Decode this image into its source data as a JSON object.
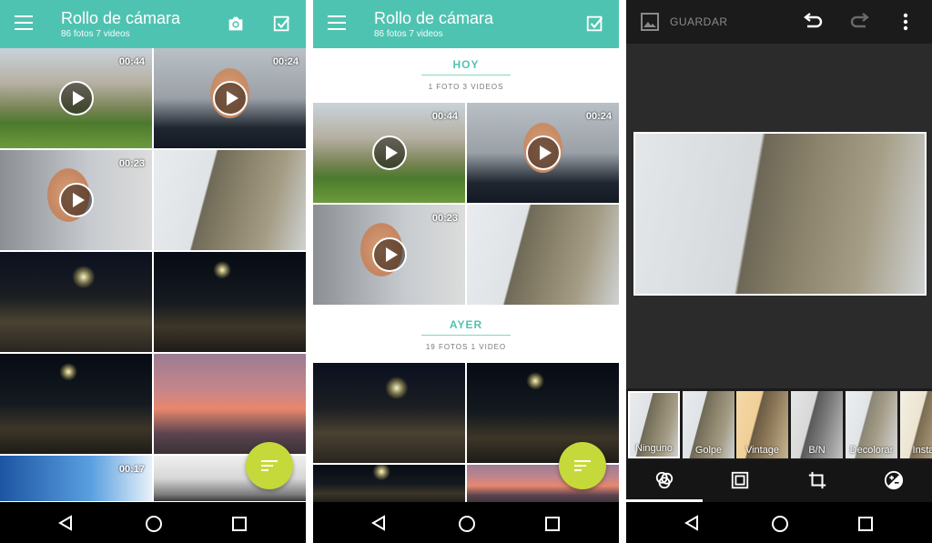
{
  "screen1": {
    "title": "Rollo de cámara",
    "subtitle": "86 fotos 7 videos",
    "durations": [
      "00:44",
      "00:24",
      "00:23",
      "00:17"
    ]
  },
  "screen2": {
    "title": "Rollo de cámara",
    "subtitle": "86 fotos 7 videos",
    "sections": [
      {
        "heading": "HOY",
        "count": "1 FOTO 3 VIDEOS"
      },
      {
        "heading": "AYER",
        "count": "19 FOTOS 1 VIDEO"
      }
    ],
    "durations": [
      "00:44",
      "00:24",
      "00:23"
    ]
  },
  "screen3": {
    "save_label": "GUARDAR",
    "filters": [
      "Ninguno",
      "Golpe",
      "Vintage",
      "B/N",
      "Decolorar",
      "Instan"
    ],
    "selected_filter": "Ninguno"
  },
  "icons": {
    "menu": "menu-icon",
    "camera": "camera-icon",
    "select": "checkbox-icon",
    "sort": "sort-icon",
    "undo": "undo-icon",
    "redo": "redo-icon",
    "overflow": "more-vert-icon",
    "filters": "filters-icon",
    "frame": "frame-icon",
    "crop": "crop-icon",
    "adjust": "exposure-icon"
  },
  "colors": {
    "appbar": "#4fc3b1",
    "fab": "#c6d93a",
    "editor_bg": "#2b2b2b"
  }
}
